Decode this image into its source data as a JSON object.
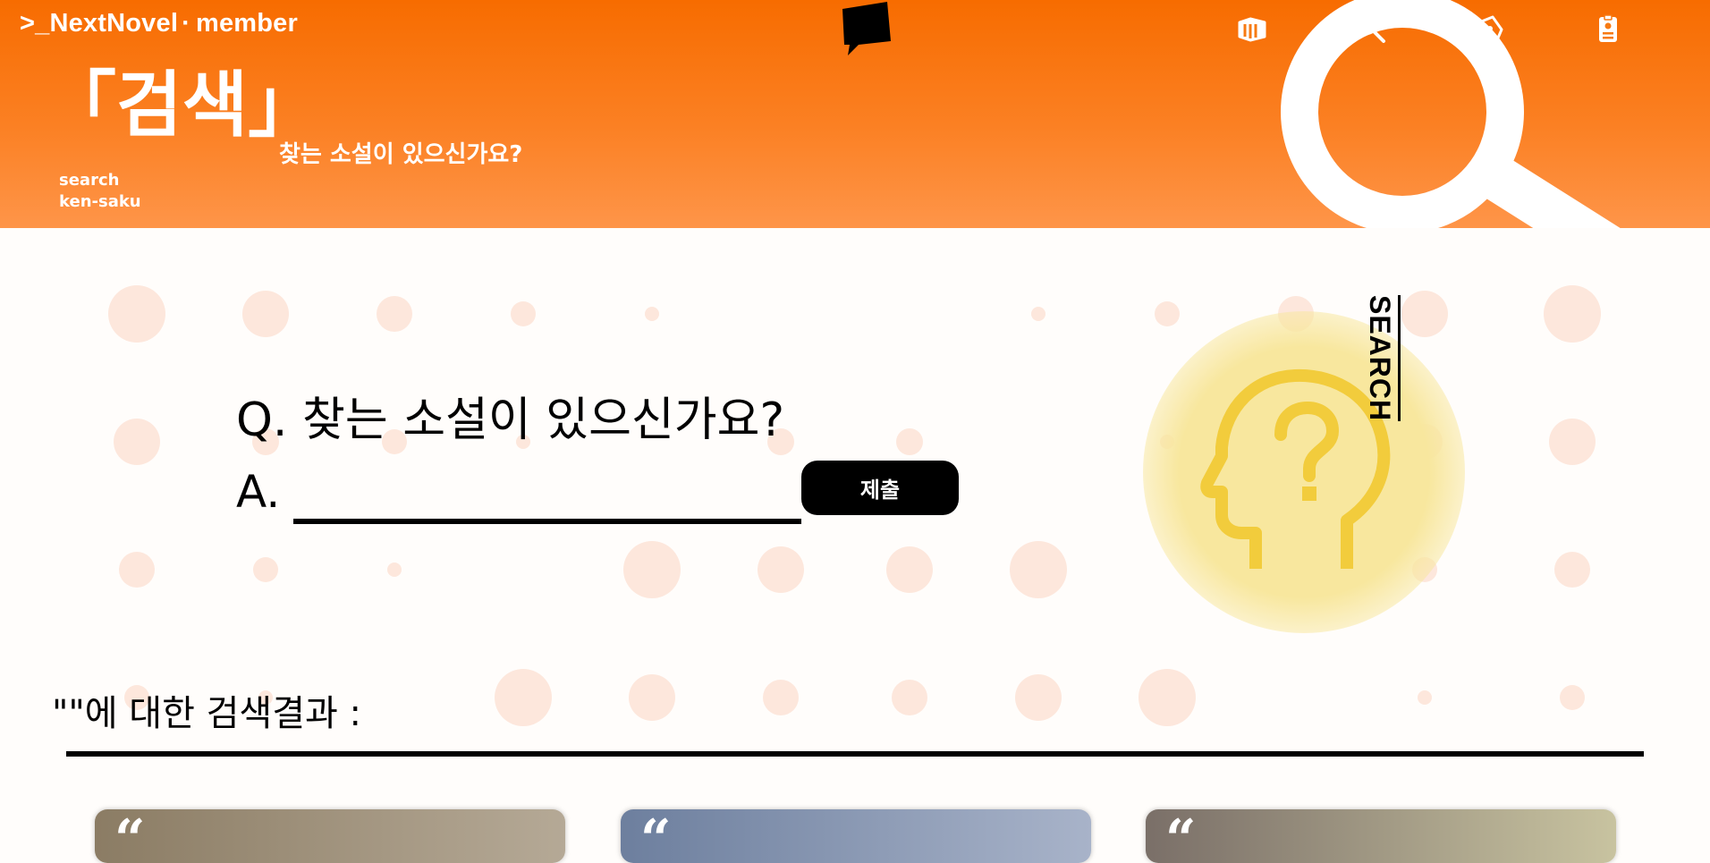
{
  "header": {
    "brand": ">_NextNovel",
    "brand_separator": "·",
    "user_label": "member",
    "title": "「검색」",
    "subtitle": "찾는 소설이 있으신가요?",
    "title_en": "search",
    "title_jp": "ken-saku",
    "nav": [
      {
        "name": "books-icon"
      },
      {
        "name": "search-icon"
      },
      {
        "name": "pen-icon"
      },
      {
        "name": "id-badge-icon"
      }
    ]
  },
  "search": {
    "question": "Q. 찾는 소설이 있으신가요?",
    "answer_label": "A.",
    "input_value": "",
    "input_placeholder": "",
    "submit_label": "제출",
    "side_label": "SEARCH"
  },
  "results": {
    "title": "\"\"에 대한 검색결과 :",
    "cards": [
      {
        "quote": "“",
        "color_from": "#8b7c64",
        "color_to": "#b5a996"
      },
      {
        "quote": "“",
        "color_from": "#6d7f9e",
        "color_to": "#a8b3c9"
      },
      {
        "quote": "“",
        "color_from": "#7a6f68",
        "color_to": "#c8c3a0"
      }
    ]
  },
  "colors": {
    "header_top": "#f76c00",
    "header_bottom": "#fe9549",
    "accent_yellow": "#f2cc3c",
    "dot": "#fde7dc"
  }
}
